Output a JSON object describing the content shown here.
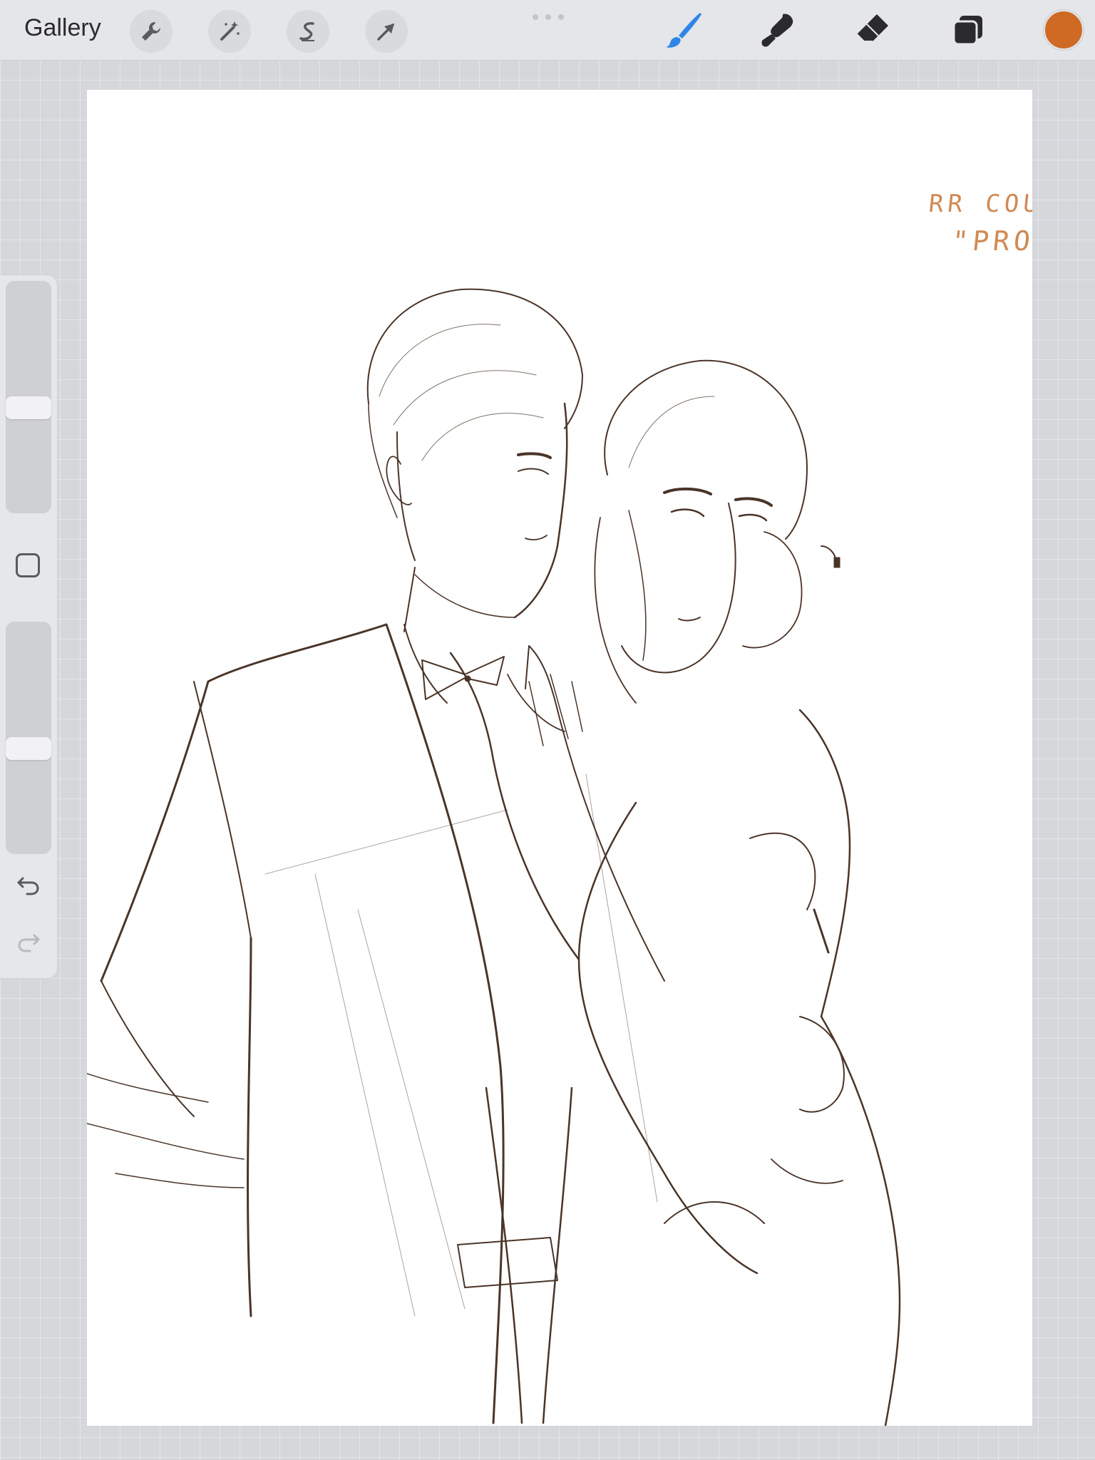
{
  "topbar": {
    "gallery_label": "Gallery",
    "left_tools": [
      {
        "name": "wrench-icon"
      },
      {
        "name": "magic-wand-icon"
      },
      {
        "name": "selection-icon"
      },
      {
        "name": "transform-arrow-icon"
      }
    ],
    "right_tools": [
      {
        "name": "brush-icon",
        "color": "#2f86e8"
      },
      {
        "name": "smudge-icon",
        "color": "#2b2b2d"
      },
      {
        "name": "eraser-icon",
        "color": "#2b2b2d"
      },
      {
        "name": "layers-icon",
        "color": "#2b2b2d"
      }
    ],
    "current_color": "#cf6a25"
  },
  "sidebar": {
    "brush_size_level": 0.55,
    "opacity_level": 0.55,
    "modify_icon": "square-icon",
    "undo_icon": "undo-icon",
    "redo_icon": "redo-icon"
  },
  "canvas": {
    "handwriting_line1": "RR COUPLE",
    "handwriting_line2": "\"PROM\"",
    "handwriting_color": "#d08a55",
    "sketch_color": "#4a3428"
  }
}
